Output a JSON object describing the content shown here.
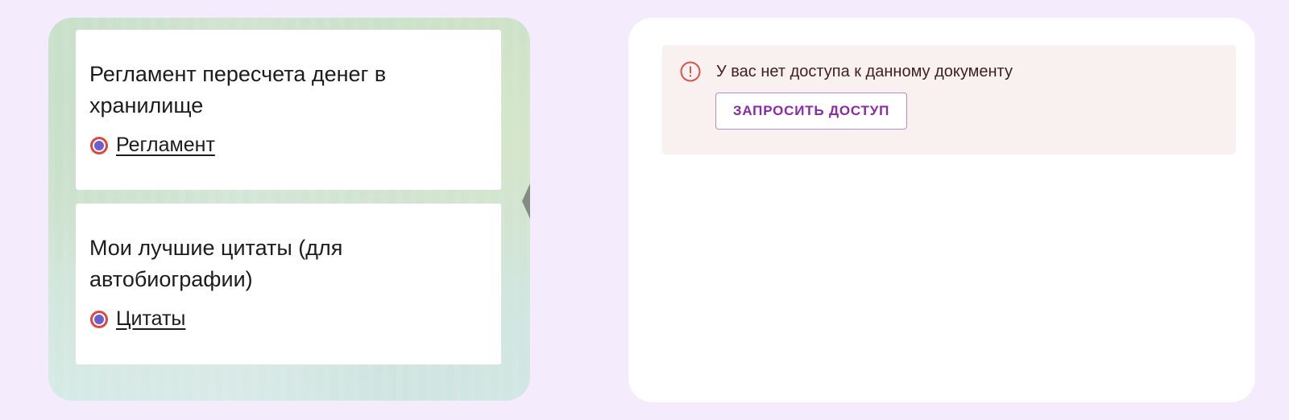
{
  "cards": [
    {
      "title": "Регламент пересчета денег в хранилище",
      "link_label": "Регламент",
      "link_icon": "target-dot-icon"
    },
    {
      "title": "Мои лучшие цитаты (для автобиографии)",
      "link_label": "Цитаты",
      "link_icon": "target-dot-icon"
    }
  ],
  "access_alert": {
    "icon": "error-circle-icon",
    "message": "У вас нет доступа к данному документу",
    "button_label": "ЗАПРОСИТЬ ДОСТУП"
  },
  "colors": {
    "page_background": "#f4ebfd",
    "alert_background": "#f9f0f0",
    "alert_icon": "#d9534f",
    "button_text": "#8a2aa8",
    "icon_ring": "#e0463b",
    "icon_center": "#6d5bd0"
  }
}
